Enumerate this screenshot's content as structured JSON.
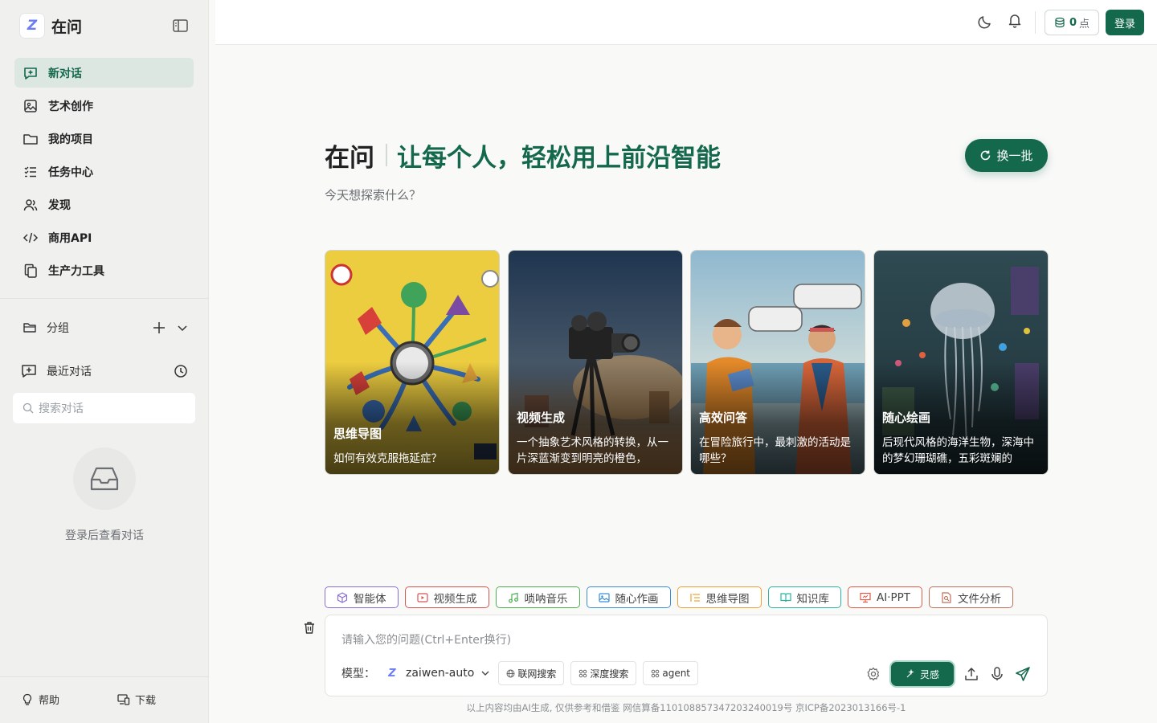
{
  "brand": {
    "name": "在问",
    "logo_glyph": "Z"
  },
  "sidebar": {
    "items": [
      {
        "label": "新对话",
        "icon": "new-chat-icon",
        "active": true
      },
      {
        "label": "艺术创作",
        "icon": "image-icon",
        "active": false
      },
      {
        "label": "我的项目",
        "icon": "folder-icon",
        "active": false
      },
      {
        "label": "任务中心",
        "icon": "task-list-icon",
        "active": false
      },
      {
        "label": "发现",
        "icon": "users-icon",
        "active": false
      },
      {
        "label": "商用API",
        "icon": "code-icon",
        "active": false
      },
      {
        "label": "生产力工具",
        "icon": "copy-icon",
        "active": false
      }
    ],
    "group_label": "分组",
    "recent_label": "最近对话",
    "search_placeholder": "搜索对话",
    "empty_text": "登录后查看对话",
    "footer": {
      "help": "帮助",
      "download": "下载"
    }
  },
  "topbar": {
    "points_value": "0",
    "points_unit": "点",
    "login_label": "登录"
  },
  "main": {
    "title": "在问",
    "slogan": "让每个人，轻松用上前沿智能",
    "refresh_label": "换一批",
    "subtitle": "今天想探索什么？",
    "cards": [
      {
        "title": "思维导图",
        "desc": "如何有效克服拖延症？"
      },
      {
        "title": "视频生成",
        "desc": "一个抽象艺术风格的转换，从一片深蓝渐变到明亮的橙色，"
      },
      {
        "title": "高效问答",
        "desc": "在冒险旅行中，最刺激的活动是哪些？"
      },
      {
        "title": "随心绘画",
        "desc": "后现代风格的海洋生物，深海中的梦幻珊瑚礁，五彩斑斓的"
      }
    ],
    "tools": [
      {
        "label": "智能体",
        "icon": "cube-icon",
        "color": "#8a6fd1"
      },
      {
        "label": "视频生成",
        "icon": "video-icon",
        "color": "#d9534f"
      },
      {
        "label": "唢呐音乐",
        "icon": "music-icon",
        "color": "#4caf50"
      },
      {
        "label": "随心作画",
        "icon": "picture-icon",
        "color": "#3b8fd9"
      },
      {
        "label": "思维导图",
        "icon": "list-icon",
        "color": "#f0a030"
      },
      {
        "label": "知识库",
        "icon": "book-icon",
        "color": "#2bb3a3"
      },
      {
        "label": "AI·PPT",
        "icon": "presentation-icon",
        "color": "#e05a4a"
      },
      {
        "label": "文件分析",
        "icon": "file-search-icon",
        "color": "#c0705a"
      }
    ],
    "input": {
      "placeholder": "请输入您的问题(Ctrl+Enter换行)",
      "model_label": "模型：",
      "model_value": "zaiwen-auto",
      "options": [
        "联网搜索",
        "深度搜索",
        "agent"
      ],
      "inspire_label": "灵感"
    },
    "footer_note": "以上内容均由AI生成, 仅供参考和借鉴 网信算备110108857347203240019号 京ICP备2023013166号-1"
  },
  "colors": {
    "accent": "#14694d",
    "active_bg": "#dce7e1"
  }
}
